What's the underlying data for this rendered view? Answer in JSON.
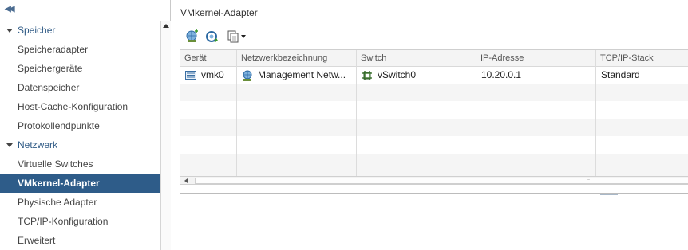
{
  "sidebar": {
    "collapse_glyph": "◀◀",
    "sections": [
      {
        "label": "Speicher",
        "items": [
          {
            "label": "Speicheradapter"
          },
          {
            "label": "Speichergeräte"
          },
          {
            "label": "Datenspeicher"
          },
          {
            "label": "Host-Cache-Konfiguration"
          },
          {
            "label": "Protokollendpunkte"
          }
        ]
      },
      {
        "label": "Netzwerk",
        "items": [
          {
            "label": "Virtuelle Switches"
          },
          {
            "label": "VMkernel-Adapter",
            "selected": true
          },
          {
            "label": "Physische Adapter"
          },
          {
            "label": "TCP/IP-Konfiguration"
          },
          {
            "label": "Erweitert"
          }
        ]
      }
    ]
  },
  "main": {
    "title": "VMkernel-Adapter",
    "toolbar": {
      "buttons": [
        {
          "icon": "add-network-icon"
        },
        {
          "icon": "refresh-icon"
        },
        {
          "icon": "copy-dropdown-icon"
        }
      ]
    },
    "table": {
      "columns": [
        "Gerät",
        "Netzwerkbezeichnung",
        "Switch",
        "IP-Adresse",
        "TCP/IP-Stack"
      ],
      "rows": [
        {
          "device": "vmk0",
          "network": "Management Netw...",
          "switch": "vSwitch0",
          "ip": "10.20.0.1",
          "stack": "Standard"
        }
      ],
      "empty_rows": 5
    },
    "scrollbar_grip": "::"
  },
  "colors": {
    "selected_bg": "#2e5c89",
    "section_text": "#2f5a85",
    "alt_row": "#f5f5f5"
  }
}
